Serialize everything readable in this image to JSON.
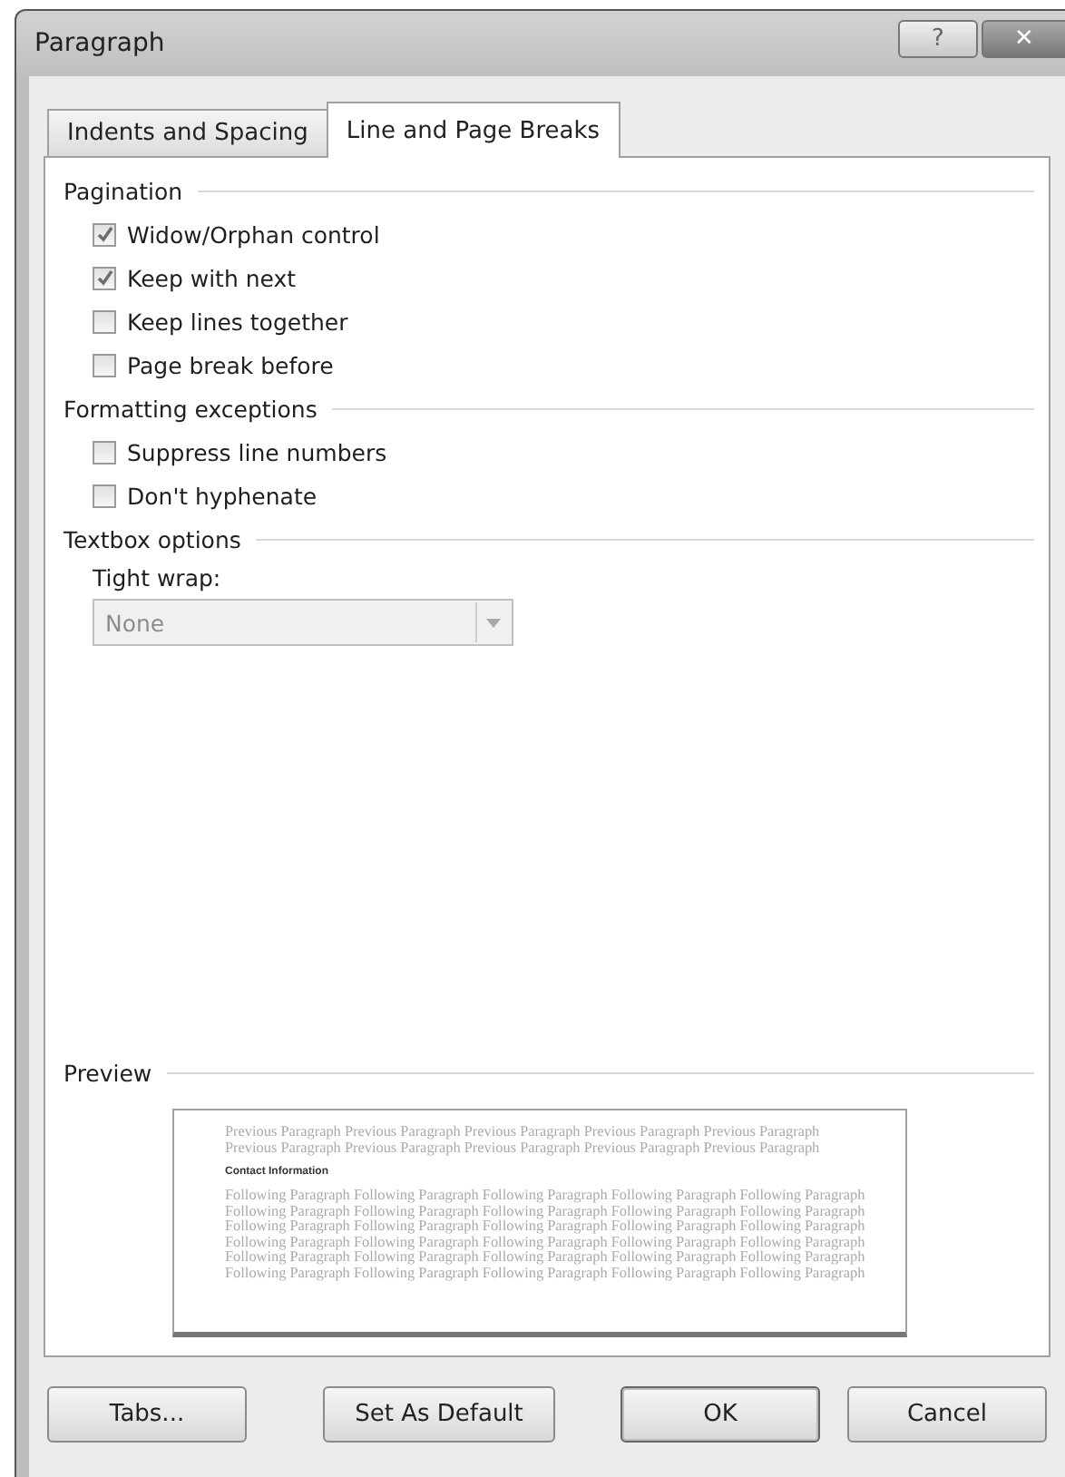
{
  "window": {
    "title": "Paragraph",
    "help": "?",
    "close": "✕"
  },
  "tabs": [
    {
      "label": "Indents and Spacing",
      "selected": false
    },
    {
      "label": "Line and Page Breaks",
      "selected": true
    }
  ],
  "sections": [
    {
      "title": "Pagination",
      "options": [
        {
          "label": "Widow/Orphan control",
          "checked": true
        },
        {
          "label": "Keep with next",
          "checked": true
        },
        {
          "label": "Keep lines together",
          "checked": false
        },
        {
          "label": "Page break before",
          "checked": false
        }
      ]
    },
    {
      "title": "Formatting exceptions",
      "options": [
        {
          "label": "Suppress line numbers",
          "checked": false
        },
        {
          "label": "Don't hyphenate",
          "checked": false
        }
      ]
    },
    {
      "title": "Textbox options",
      "field": {
        "label": "Tight wrap:",
        "value": "None",
        "disabled": true
      }
    }
  ],
  "preview": {
    "title": "Preview",
    "previous_lines": [
      "Previous Paragraph Previous Paragraph Previous Paragraph Previous Paragraph Previous Paragraph",
      "Previous Paragraph Previous Paragraph Previous Paragraph Previous Paragraph Previous Paragraph"
    ],
    "heading": "Contact Information",
    "following_lines": [
      "Following Paragraph Following Paragraph Following Paragraph Following Paragraph Following Paragraph",
      "Following Paragraph Following Paragraph Following Paragraph Following Paragraph Following Paragraph",
      "Following Paragraph Following Paragraph Following Paragraph Following Paragraph Following Paragraph",
      "Following Paragraph Following Paragraph Following Paragraph Following Paragraph Following Paragraph",
      "Following Paragraph Following Paragraph Following Paragraph Following Paragraph Following Paragraph",
      "Following Paragraph Following Paragraph Following Paragraph Following Paragraph Following Paragraph"
    ]
  },
  "buttons": [
    {
      "label": "Tabs...",
      "kind": "left"
    },
    {
      "label": "Set As Default",
      "kind": "left"
    },
    {
      "label": "OK",
      "kind": "default"
    },
    {
      "label": "Cancel",
      "kind": "normal"
    }
  ]
}
